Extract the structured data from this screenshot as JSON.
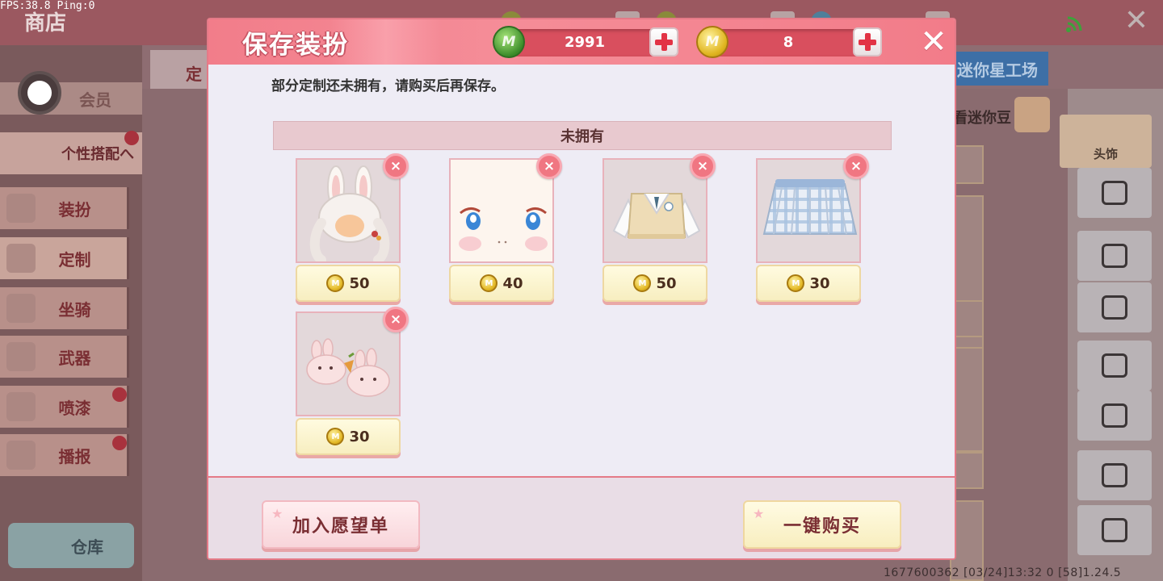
{
  "debug": {
    "fps_text": "FPS:38.8  Ping:0"
  },
  "background": {
    "shop_title": "商店",
    "sidebar": {
      "vip_label": "会员",
      "custom_outfit_label": "个性搭配へ",
      "items": [
        "装扮",
        "定制",
        "坐骑",
        "武器",
        "喷漆",
        "播报"
      ],
      "warehouse_label": "仓库"
    },
    "tab_left_fragment": "定",
    "tab_right_label": "迷你星工场",
    "search_text_fragment": "看迷你豆",
    "headwear_label": "头饰",
    "footer_info": "1677600362  [03/24]13:32 0  [58]1.24.5"
  },
  "modal": {
    "title": "保存装扮",
    "currencies": {
      "gem": {
        "value": "2991",
        "icon": "green-gem-icon",
        "icon_glyph": "M"
      },
      "coin": {
        "value": "8",
        "icon": "gold-coin-icon",
        "icon_glyph": "M"
      }
    },
    "notice": "部分定制还未拥有，请购买后再保存。",
    "section_title": "未拥有",
    "items": [
      {
        "price": "50",
        "icon": "bunny-ear-hair-icon"
      },
      {
        "price": "40",
        "icon": "face-icon"
      },
      {
        "price": "50",
        "icon": "sweater-vest-top-icon"
      },
      {
        "price": "30",
        "icon": "plaid-skirt-icon"
      },
      {
        "price": "30",
        "icon": "bunny-slippers-icon"
      }
    ],
    "remove_glyph": "×",
    "coin_glyph": "M",
    "wishlist_label": "加入愿望单",
    "buy_all_label": "一键购买"
  },
  "colors": {
    "accent": "#f27d8a",
    "close": "#ffffff",
    "remove": "#f07682",
    "price_bg": "#fffbe0"
  }
}
